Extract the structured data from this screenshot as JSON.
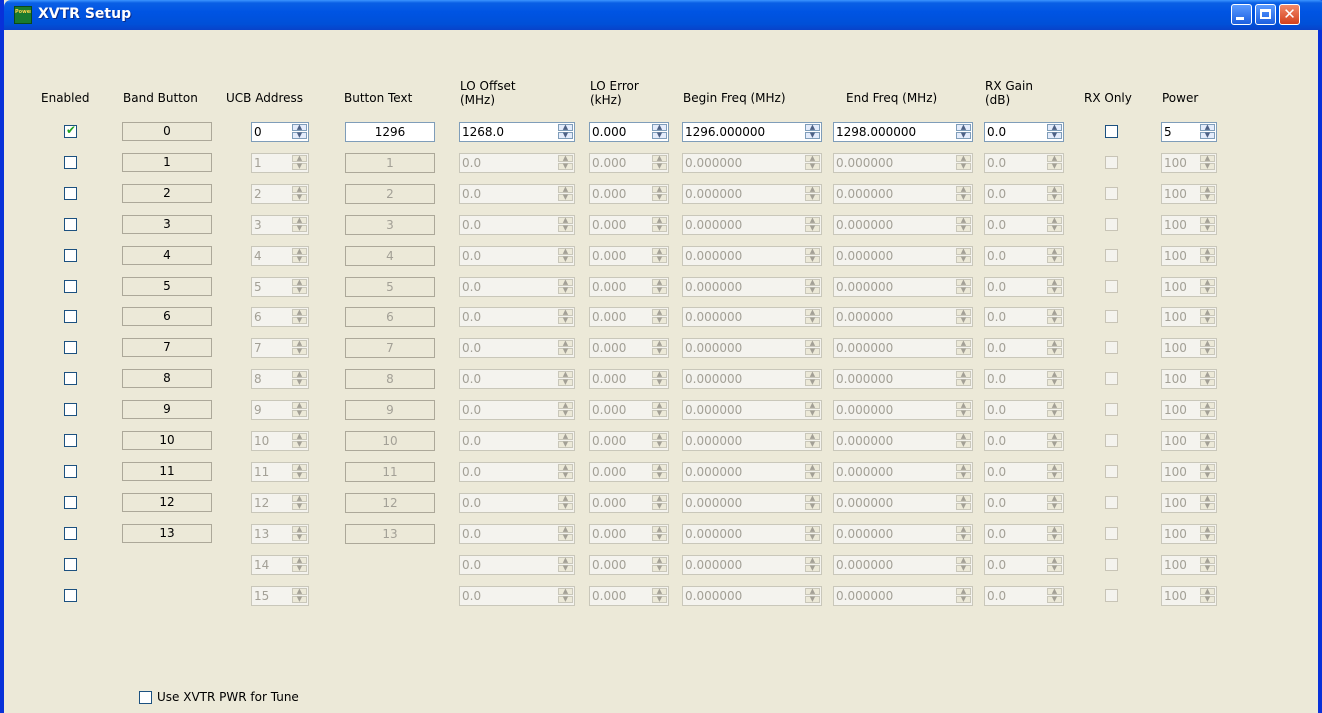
{
  "window": {
    "title": "XVTR Setup",
    "app_icon_text": "PowerSDR",
    "minimize_label": "",
    "maximize_label": "",
    "close_label": "✕"
  },
  "headers": {
    "enabled": "Enabled",
    "band_button": "Band Button",
    "ucb_address": "UCB Address",
    "button_text": "Button Text",
    "lo_offset": "LO Offset\n(MHz)",
    "lo_error": "LO Error\n(kHz)",
    "begin_freq": "Begin Freq (MHz)",
    "end_freq": "End Freq (MHz)",
    "rx_gain": "RX Gain\n(dB)",
    "rx_only": "RX Only",
    "power": "Power"
  },
  "rows": [
    {
      "enabled": true,
      "band": "0",
      "ucb": "0",
      "text": "1296",
      "lo": "1268.0",
      "err": "0.000",
      "begin": "1296.000000",
      "end": "1298.000000",
      "gain": "0.0",
      "rxonly": false,
      "power": "5"
    },
    {
      "enabled": false,
      "band": "1",
      "ucb": "1",
      "text": "1",
      "lo": "0.0",
      "err": "0.000",
      "begin": "0.000000",
      "end": "0.000000",
      "gain": "0.0",
      "rxonly": false,
      "power": "100"
    },
    {
      "enabled": false,
      "band": "2",
      "ucb": "2",
      "text": "2",
      "lo": "0.0",
      "err": "0.000",
      "begin": "0.000000",
      "end": "0.000000",
      "gain": "0.0",
      "rxonly": false,
      "power": "100"
    },
    {
      "enabled": false,
      "band": "3",
      "ucb": "3",
      "text": "3",
      "lo": "0.0",
      "err": "0.000",
      "begin": "0.000000",
      "end": "0.000000",
      "gain": "0.0",
      "rxonly": false,
      "power": "100"
    },
    {
      "enabled": false,
      "band": "4",
      "ucb": "4",
      "text": "4",
      "lo": "0.0",
      "err": "0.000",
      "begin": "0.000000",
      "end": "0.000000",
      "gain": "0.0",
      "rxonly": false,
      "power": "100"
    },
    {
      "enabled": false,
      "band": "5",
      "ucb": "5",
      "text": "5",
      "lo": "0.0",
      "err": "0.000",
      "begin": "0.000000",
      "end": "0.000000",
      "gain": "0.0",
      "rxonly": false,
      "power": "100"
    },
    {
      "enabled": false,
      "band": "6",
      "ucb": "6",
      "text": "6",
      "lo": "0.0",
      "err": "0.000",
      "begin": "0.000000",
      "end": "0.000000",
      "gain": "0.0",
      "rxonly": false,
      "power": "100"
    },
    {
      "enabled": false,
      "band": "7",
      "ucb": "7",
      "text": "7",
      "lo": "0.0",
      "err": "0.000",
      "begin": "0.000000",
      "end": "0.000000",
      "gain": "0.0",
      "rxonly": false,
      "power": "100"
    },
    {
      "enabled": false,
      "band": "8",
      "ucb": "8",
      "text": "8",
      "lo": "0.0",
      "err": "0.000",
      "begin": "0.000000",
      "end": "0.000000",
      "gain": "0.0",
      "rxonly": false,
      "power": "100"
    },
    {
      "enabled": false,
      "band": "9",
      "ucb": "9",
      "text": "9",
      "lo": "0.0",
      "err": "0.000",
      "begin": "0.000000",
      "end": "0.000000",
      "gain": "0.0",
      "rxonly": false,
      "power": "100"
    },
    {
      "enabled": false,
      "band": "10",
      "ucb": "10",
      "text": "10",
      "lo": "0.0",
      "err": "0.000",
      "begin": "0.000000",
      "end": "0.000000",
      "gain": "0.0",
      "rxonly": false,
      "power": "100"
    },
    {
      "enabled": false,
      "band": "11",
      "ucb": "11",
      "text": "11",
      "lo": "0.0",
      "err": "0.000",
      "begin": "0.000000",
      "end": "0.000000",
      "gain": "0.0",
      "rxonly": false,
      "power": "100"
    },
    {
      "enabled": false,
      "band": "12",
      "ucb": "12",
      "text": "12",
      "lo": "0.0",
      "err": "0.000",
      "begin": "0.000000",
      "end": "0.000000",
      "gain": "0.0",
      "rxonly": false,
      "power": "100"
    },
    {
      "enabled": false,
      "band": "13",
      "ucb": "13",
      "text": "13",
      "lo": "0.0",
      "err": "0.000",
      "begin": "0.000000",
      "end": "0.000000",
      "gain": "0.0",
      "rxonly": false,
      "power": "100"
    },
    {
      "enabled": false,
      "band": null,
      "ucb": "14",
      "text": null,
      "lo": "0.0",
      "err": "0.000",
      "begin": "0.000000",
      "end": "0.000000",
      "gain": "0.0",
      "rxonly": false,
      "power": "100"
    },
    {
      "enabled": false,
      "band": null,
      "ucb": "15",
      "text": null,
      "lo": "0.0",
      "err": "0.000",
      "begin": "0.000000",
      "end": "0.000000",
      "gain": "0.0",
      "rxonly": false,
      "power": "100"
    }
  ],
  "footer": {
    "use_xvtr_pwr_label": "Use XVTR PWR for Tune",
    "use_xvtr_pwr_checked": false
  },
  "colors": {
    "titlebar": "#0054e3",
    "window_bg": "#ece9d8",
    "check_mark": "#21a121",
    "disabled_text": "#a3a096"
  }
}
